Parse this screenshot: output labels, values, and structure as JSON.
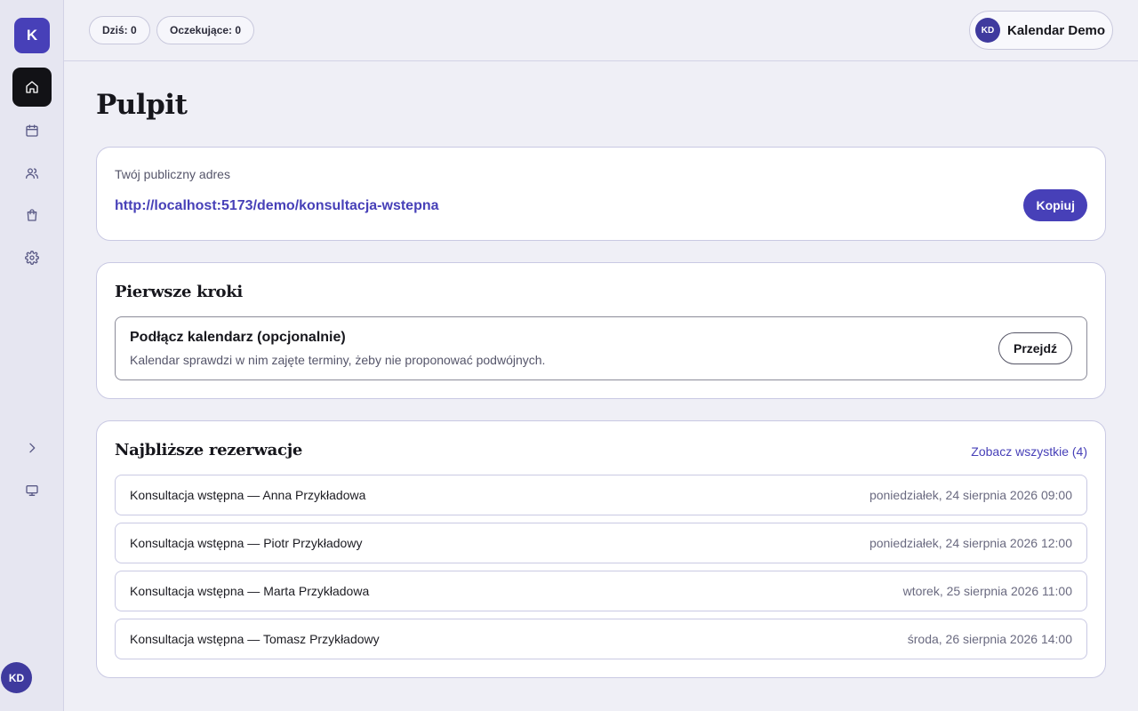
{
  "sidebar": {
    "brand_letter": "K",
    "nav": [
      {
        "icon": "home-icon",
        "active": true
      },
      {
        "icon": "calendar-icon",
        "active": false
      },
      {
        "icon": "users-icon",
        "active": false
      },
      {
        "icon": "shopping-bag-icon",
        "active": false
      },
      {
        "icon": "gear-icon",
        "active": false
      }
    ],
    "expand_icon": "chevron-right-icon",
    "display_icon": "monitor-icon",
    "user_initials": "KD"
  },
  "topbar": {
    "today_chip": "Dziś: 0",
    "pending_chip": "Oczekujące: 0",
    "user": {
      "initials": "KD",
      "name": "Kalendar Demo"
    }
  },
  "page": {
    "title": "Pulpit"
  },
  "public_url": {
    "label": "Twój publiczny adres",
    "url": "http://localhost:5173/demo/konsultacja-wstepna",
    "copy_button": "Kopiuj"
  },
  "first_steps": {
    "title": "Pierwsze kroki",
    "step": {
      "title": "Podłącz kalendarz (opcjonalnie)",
      "description": "Kalendar sprawdzi w nim zajęte terminy, żeby nie proponować podwójnych.",
      "button": "Przejdź"
    }
  },
  "upcoming": {
    "title": "Najbliższe rezerwacje",
    "see_all": "Zobacz wszystkie (4)",
    "items": [
      {
        "title": "Konsultacja wstępna — Anna Przykładowa",
        "date": "poniedziałek, 24 sierpnia 2026 09:00"
      },
      {
        "title": "Konsultacja wstępna — Piotr Przykładowy",
        "date": "poniedziałek, 24 sierpnia 2026 12:00"
      },
      {
        "title": "Konsultacja wstępna — Marta Przykładowa",
        "date": "wtorek, 25 sierpnia 2026 11:00"
      },
      {
        "title": "Konsultacja wstępna — Tomasz Przykładowy",
        "date": "środa, 26 sierpnia 2026 14:00"
      }
    ]
  },
  "colors": {
    "accent": "#4740b8",
    "background": "#efeff6",
    "sidebar": "#e6e6f1",
    "active_nav": "#121216"
  }
}
